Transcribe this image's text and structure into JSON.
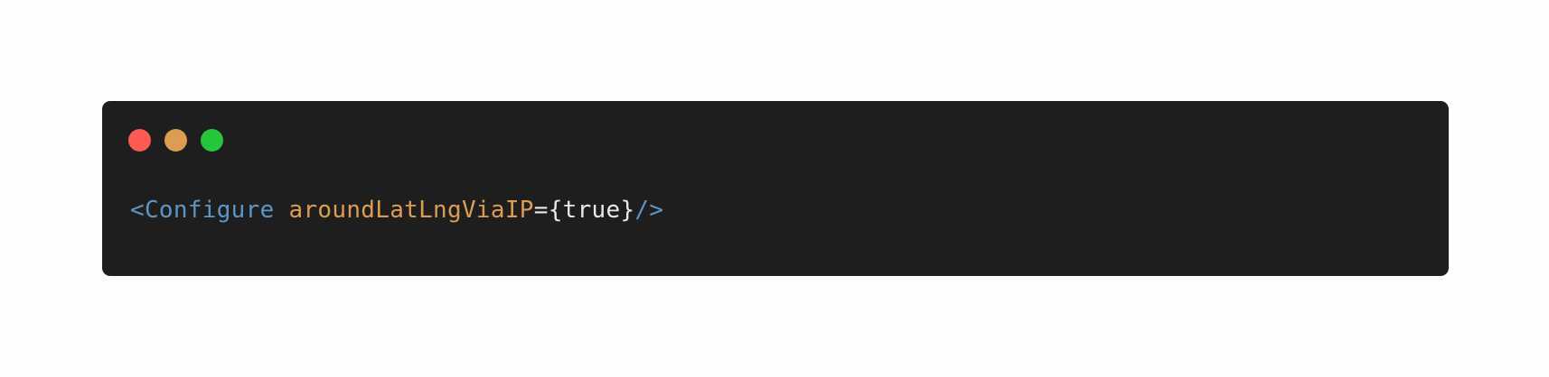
{
  "window": {
    "controls": [
      {
        "name": "close",
        "color": "#fc5a52"
      },
      {
        "name": "minimize",
        "color": "#dd9d51"
      },
      {
        "name": "maximize",
        "color": "#25c63a"
      }
    ]
  },
  "code": {
    "tokens": [
      {
        "text": "<Configure",
        "kind": "tag",
        "color": "#5d95c5"
      },
      {
        "text": " ",
        "kind": "space"
      },
      {
        "text": "aroundLatLngViaIP",
        "kind": "attribute",
        "color": "#dd9d51"
      },
      {
        "text": "={true}",
        "kind": "plain",
        "color": "#e9e9e9"
      },
      {
        "text": "/>",
        "kind": "tag",
        "color": "#5d95c5"
      }
    ]
  },
  "theme": {
    "page_background": "#fdfdfd",
    "editor_background": "#1e1e1e"
  }
}
